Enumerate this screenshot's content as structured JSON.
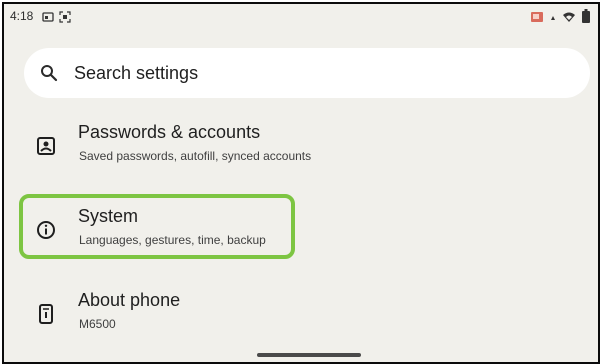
{
  "status_bar": {
    "time": "4:18",
    "icons": [
      "cast-icon",
      "screenshot-icon",
      "wifi-icon",
      "battery-icon"
    ]
  },
  "search": {
    "placeholder": "Search settings"
  },
  "settings_items": [
    {
      "title": "Passwords & accounts",
      "subtitle": "Saved passwords, autofill, synced accounts",
      "icon": "account-box-icon"
    },
    {
      "title": "System",
      "subtitle": "Languages, gestures, time, backup",
      "icon": "info-icon"
    },
    {
      "title": "About phone",
      "subtitle": "M6500",
      "icon": "phone-icon"
    }
  ],
  "colors": {
    "background": "#f1f0eb",
    "highlight": "#7dc542"
  }
}
